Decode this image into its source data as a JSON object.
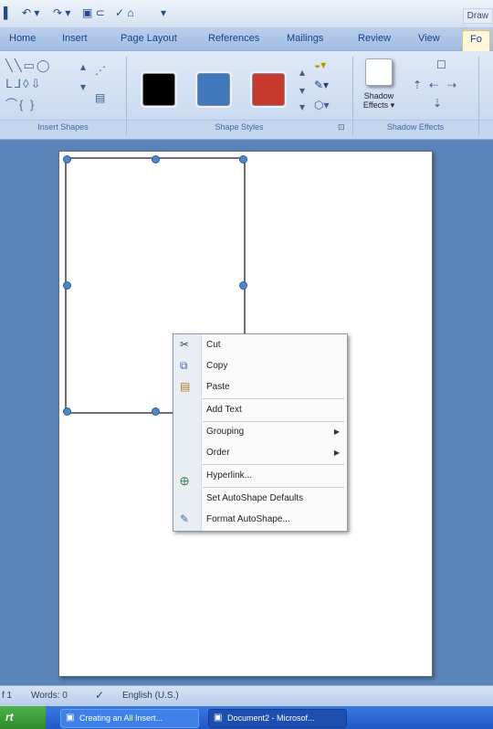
{
  "title_bar": {
    "doc_title": "Draw",
    "qat_icons": [
      "save-icon",
      "undo-icon",
      "redo-icon",
      "print-preview-icon",
      "customize-icon"
    ]
  },
  "tabs": [
    {
      "label": "Home"
    },
    {
      "label": "Insert"
    },
    {
      "label": "Page Layout"
    },
    {
      "label": "References"
    },
    {
      "label": "Mailings"
    },
    {
      "label": "Review"
    },
    {
      "label": "View"
    },
    {
      "label": "Fo"
    }
  ],
  "ribbon": {
    "groups": {
      "insert_shapes": "Insert Shapes",
      "shape_styles": "Shape Styles",
      "shadow_effects": "Shadow Effects"
    },
    "swatches": [
      "#000000",
      "#3f78bd",
      "#c8392d"
    ],
    "shadow_button": {
      "line1": "Shadow",
      "line2": "Effects ▾"
    }
  },
  "context_menu": {
    "items": [
      {
        "label": "Cut",
        "icon": "scissors-icon"
      },
      {
        "label": "Copy",
        "icon": "copy-icon"
      },
      {
        "label": "Paste",
        "icon": "paste-icon"
      },
      {
        "label": "Add Text",
        "icon": ""
      },
      {
        "label": "Grouping",
        "icon": "",
        "submenu": true
      },
      {
        "label": "Order",
        "icon": "",
        "submenu": true
      },
      {
        "label": "Hyperlink...",
        "icon": "hyperlink-icon"
      },
      {
        "label": "Set AutoShape Defaults",
        "icon": ""
      },
      {
        "label": "Format AutoShape...",
        "icon": "format-shape-icon"
      }
    ]
  },
  "status_bar": {
    "page": "f 1",
    "words": "Words: 0",
    "language": "English (U.S.)"
  },
  "taskbar": {
    "start": "rt",
    "buttons": [
      {
        "label": "Creating an All Insert..."
      },
      {
        "label": "Document2 - Microsof..."
      }
    ]
  }
}
